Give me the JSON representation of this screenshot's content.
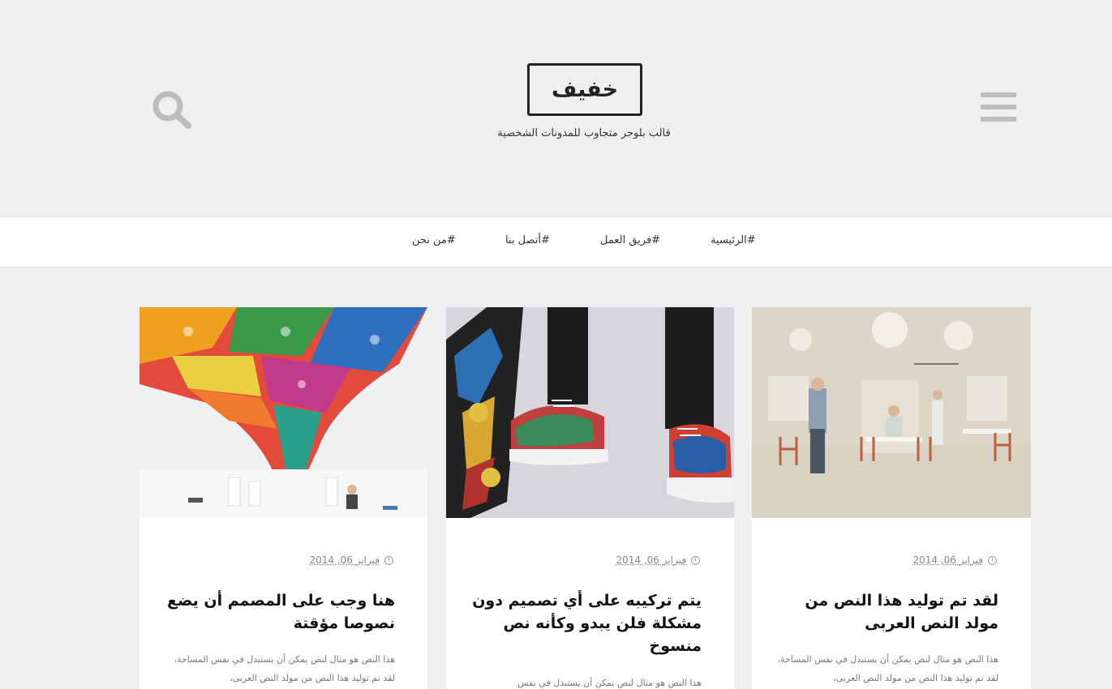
{
  "header": {
    "logo": "خفيف",
    "tagline": "قالب بلوجر متجاوب للمدونات الشخصية"
  },
  "nav": {
    "items": [
      "#الرئيسية",
      "#فريق العمل",
      "#أتصل بنا",
      "#من نحن"
    ]
  },
  "posts": [
    {
      "date": "فبراير 06, 2014",
      "title": "لقد تم توليد هذا النص من مولد النص العربى",
      "excerpt": "هذا النص هو مثال لنص يمكن أن يستبدل في نفس المساحة، لقد تم توليد هذا النص من مولد النص العربى،"
    },
    {
      "date": "فبراير 06, 2014",
      "title": "يتم تركيبه على أي تصميم دون مشكلة فلن يبدو وكأنه نص منسوخ",
      "excerpt": "هذا النص هو مثال لنص يمكن أن يستبدل في نفس"
    },
    {
      "date": "فبراير 06, 2014",
      "title": "هنا وجب على المصمم أن يضع نصوصا مؤقتة",
      "excerpt": "هذا النص هو مثال لنص يمكن أن يستبدل في نفس المساحة، لقد تم توليد هذا النص من مولد النص العربى،"
    }
  ],
  "icons": {
    "menu": "hamburger-menu-icon",
    "search": "search-icon",
    "date": "clock-icon"
  },
  "colors": {
    "page_bg": "#efefef",
    "nav_bg": "#ffffff",
    "icon_gray": "#bcbcbc",
    "text_dark": "#111111"
  }
}
